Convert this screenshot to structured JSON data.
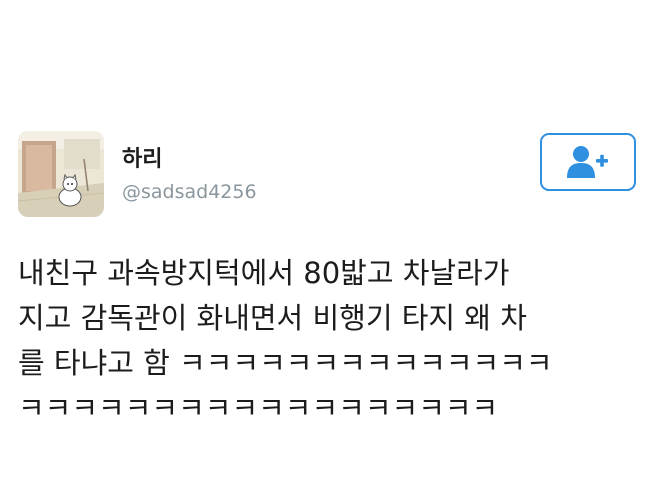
{
  "user": {
    "display_name": "하리",
    "handle": "@sadsad4256",
    "avatar_icon": "cartoon-cat-avatar"
  },
  "follow_button": {
    "icon": "add-user-icon",
    "accent_color": "#2f8fe0"
  },
  "tweet": {
    "lines": [
      "내친구 과속방지턱에서 80밟고 차날라가",
      "지고 감독관이 화내면서 비행기 타지 왜 차",
      "를 타냐고 함 ㅋㅋㅋㅋㅋㅋㅋㅋㅋㅋㅋㅋㅋㅋ",
      "ㅋㅋㅋㅋㅋㅋㅋㅋㅋㅋㅋㅋㅋㅋㅋㅋㅋㅋ"
    ]
  }
}
